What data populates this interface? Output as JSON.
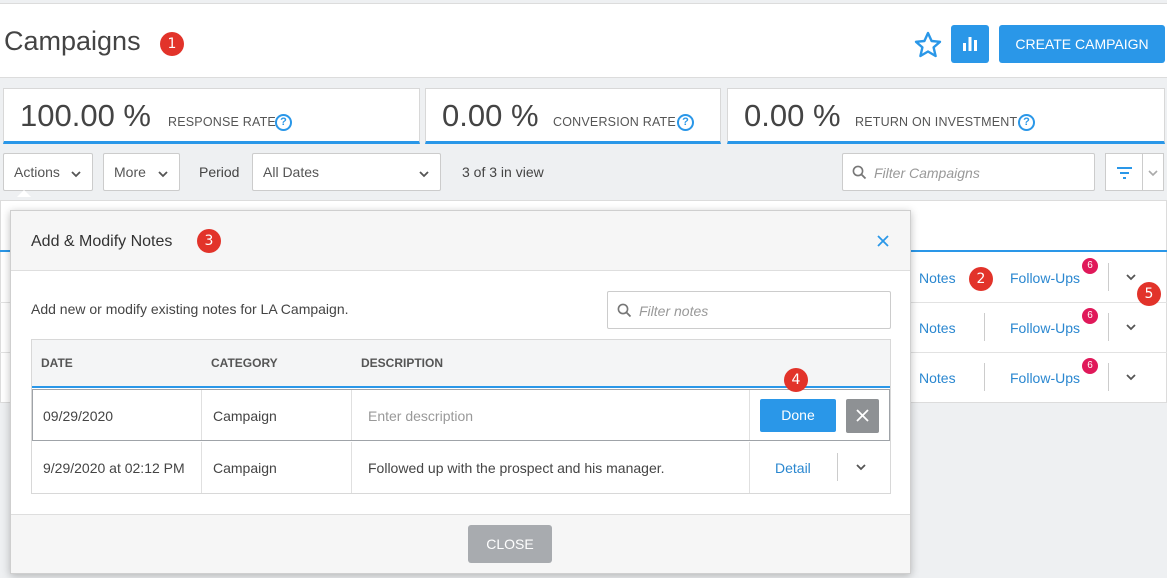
{
  "header": {
    "title": "Campaigns",
    "create_label": "CREATE CAMPAIGN"
  },
  "markers": [
    "1",
    "2",
    "3",
    "4",
    "5"
  ],
  "kpis": [
    {
      "value": "100.00 %",
      "label": "RESPONSE RATE"
    },
    {
      "value": "0.00 %",
      "label": "CONVERSION RATE"
    },
    {
      "value": "0.00 %",
      "label": "RETURN ON INVESTMENT"
    }
  ],
  "toolbar": {
    "actions_label": "Actions",
    "more_label": "More",
    "period_label": "Period",
    "period_value": "All Dates",
    "in_view": "3 of 3 in view",
    "filter_placeholder": "Filter Campaigns"
  },
  "campaign_rows": [
    {
      "notes": "Notes",
      "followups": "Follow-Ups",
      "count": "6"
    },
    {
      "notes": "Notes",
      "followups": "Follow-Ups",
      "count": "6"
    },
    {
      "notes": "Notes",
      "followups": "Follow-Ups",
      "count": "6"
    }
  ],
  "modal": {
    "title": "Add & Modify Notes",
    "description": "Add new or modify existing notes for LA Campaign.",
    "filter_placeholder": "Filter notes",
    "columns": [
      "DATE",
      "CATEGORY",
      "DESCRIPTION"
    ],
    "edit_row": {
      "date": "09/29/2020",
      "category": "Campaign",
      "placeholder": "Enter description",
      "done_label": "Done"
    },
    "rows": [
      {
        "date": "9/29/2020 at 02:12 PM",
        "category": "Campaign",
        "description": "Followed up with the prospect and his manager.",
        "action": "Detail"
      }
    ],
    "close_label": "CLOSE"
  },
  "colors": {
    "accent": "#2a97e8",
    "marker": "#e2332a",
    "count_badge": "#e0195a"
  }
}
